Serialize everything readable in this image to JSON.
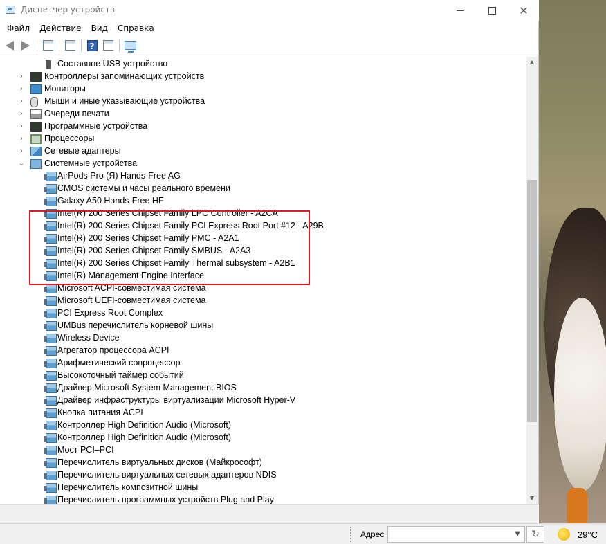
{
  "window": {
    "title": "Диспетчер устройств"
  },
  "menu": [
    "Файл",
    "Действие",
    "Вид",
    "Справка"
  ],
  "tree": {
    "top_item": "Составное USB устройство",
    "categories": [
      {
        "label": "Контроллеры запоминающих устройств",
        "icon": "storage-controller-icon",
        "expanded": false
      },
      {
        "label": "Мониторы",
        "icon": "monitor-icon",
        "expanded": false
      },
      {
        "label": "Мыши и иные указывающие устройства",
        "icon": "mouse-icon",
        "expanded": false
      },
      {
        "label": "Очереди печати",
        "icon": "printer-icon",
        "expanded": false
      },
      {
        "label": "Программные устройства",
        "icon": "software-device-icon",
        "expanded": false
      },
      {
        "label": "Процессоры",
        "icon": "processor-icon",
        "expanded": false
      },
      {
        "label": "Сетевые адаптеры",
        "icon": "network-adapter-icon",
        "expanded": false
      },
      {
        "label": "Системные устройства",
        "icon": "system-device-icon",
        "expanded": true
      }
    ],
    "system_devices": [
      "AirPods Pro (Я) Hands-Free AG",
      "CMOS системы и часы реального времени",
      "Galaxy A50 Hands-Free HF",
      "Intel(R) 200 Series Chipset Family LPC Controller - A2CA",
      "Intel(R) 200 Series Chipset Family PCI Express Root Port #12 - A29B",
      "Intel(R) 200 Series Chipset Family PMC - A2A1",
      "Intel(R) 200 Series Chipset Family SMBUS - A2A3",
      "Intel(R) 200 Series Chipset Family Thermal subsystem - A2B1",
      "Intel(R) Management Engine Interface",
      "Microsoft ACPI-совместимая система",
      "Microsoft UEFI-совместимая система",
      "PCI Express Root Complex",
      "UMBus перечислитель корневой шины",
      "Wireless Device",
      "Агрегатор процессора ACPI",
      "Арифметический сопроцессор",
      "Высокоточный таймер событий",
      "Драйвер Microsoft System Management BIOS",
      "Драйвер инфраструктуры виртуализации Microsoft Hyper-V",
      "Кнопка питания ACPI",
      "Контроллер High Definition Audio (Microsoft)",
      "Контроллер High Definition Audio (Microsoft)",
      "Мост PCI–PCI",
      "Перечислитель виртуальных дисков (Майкрософт)",
      "Перечислитель виртуальных сетевых адаптеров NDIS",
      "Перечислитель композитной шины",
      "Перечислитель программных устройств Plug and Play"
    ]
  },
  "taskbar": {
    "address_label": "Адрес",
    "address_value": "",
    "temperature": "29°C"
  },
  "colors": {
    "highlight": "#e01b24",
    "window_bg": "#ffffff",
    "taskbar_bg": "#f0f0f0"
  }
}
